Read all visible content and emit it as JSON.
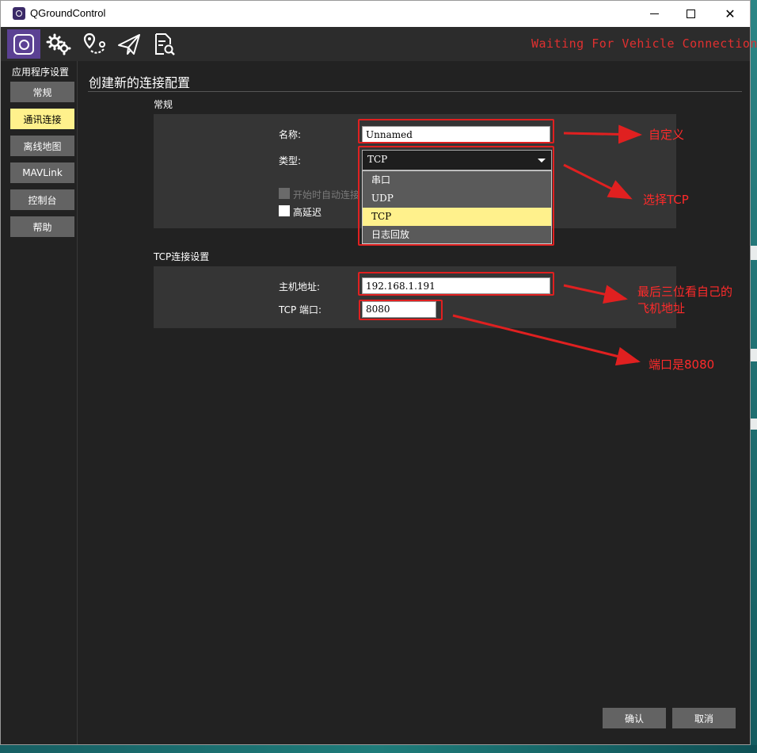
{
  "window": {
    "title": "QGroundControl",
    "status_text": "Waiting For Vehicle Connection"
  },
  "toolbar": {
    "icons": [
      "qgc-logo-icon",
      "settings-gears-icon",
      "plan-route-icon",
      "fly-paper-plane-icon",
      "analyze-document-icon"
    ]
  },
  "sidebar": {
    "title": "应用程序设置",
    "items": [
      {
        "label": "常规",
        "active": false
      },
      {
        "label": "通讯连接",
        "active": true
      },
      {
        "label": "离线地图",
        "active": false
      },
      {
        "label": "MAVLink",
        "active": false
      },
      {
        "label": "控制台",
        "active": false
      },
      {
        "label": "帮助",
        "active": false
      }
    ]
  },
  "page": {
    "title": "创建新的连接配置"
  },
  "general": {
    "section_label": "常规",
    "name_label": "名称:",
    "name_value": "Unnamed",
    "type_label": "类型:",
    "type_value": "TCP",
    "type_options": [
      {
        "label": "串口",
        "selected": false
      },
      {
        "label": "UDP",
        "selected": false
      },
      {
        "label": "TCP",
        "selected": true
      },
      {
        "label": "日志回放",
        "selected": false
      }
    ],
    "auto_connect_label": "开始时自动连接",
    "auto_connect_enabled": false,
    "high_latency_label": "高延迟",
    "high_latency_checked": false
  },
  "tcp": {
    "section_label": "TCP连接设置",
    "host_label": "主机地址:",
    "host_value": "192.168.1.191",
    "port_label": "TCP 端口:",
    "port_value": "8080"
  },
  "actions": {
    "confirm_label": "确认",
    "cancel_label": "取消"
  },
  "annotations": {
    "name_note": "自定义",
    "type_note": "选择TCP",
    "host_note_line1": "最后三位看自己的",
    "host_note_line2": "飞机地址",
    "port_note": "端口是8080",
    "color": "#e02020"
  },
  "colors": {
    "accent_active": "#fff18c",
    "toolbar_active": "#5b4193",
    "status_red": "#e03030"
  }
}
